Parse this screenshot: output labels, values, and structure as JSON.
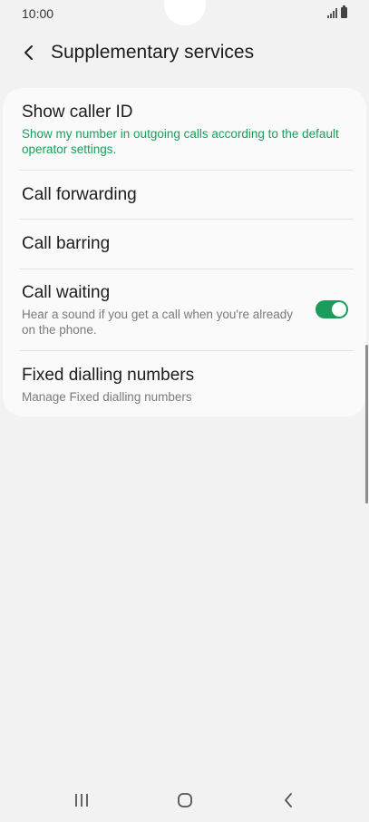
{
  "status_bar": {
    "time": "10:00"
  },
  "header": {
    "title": "Supplementary services"
  },
  "settings": [
    {
      "title": "Show caller ID",
      "subtitle": "Show my number in outgoing calls according to the default operator settings."
    },
    {
      "title": "Call forwarding"
    },
    {
      "title": "Call barring"
    },
    {
      "title": "Call waiting",
      "subtitle": "Hear a sound if you get a call when you're already on the phone.",
      "toggle_on": true
    },
    {
      "title": "Fixed dialling numbers",
      "subtitle": "Manage Fixed dialling numbers"
    }
  ],
  "colors": {
    "accent": "#1b9c5a",
    "subtitle_green": "#17a05a",
    "background": "#f2f2f2",
    "card": "#fafafa"
  },
  "icons": {
    "back": "chevron-left-icon",
    "signal": "signal-icon",
    "battery": "battery-icon",
    "recents": "recents-icon",
    "home": "home-icon",
    "nav_back": "nav-back-icon"
  }
}
